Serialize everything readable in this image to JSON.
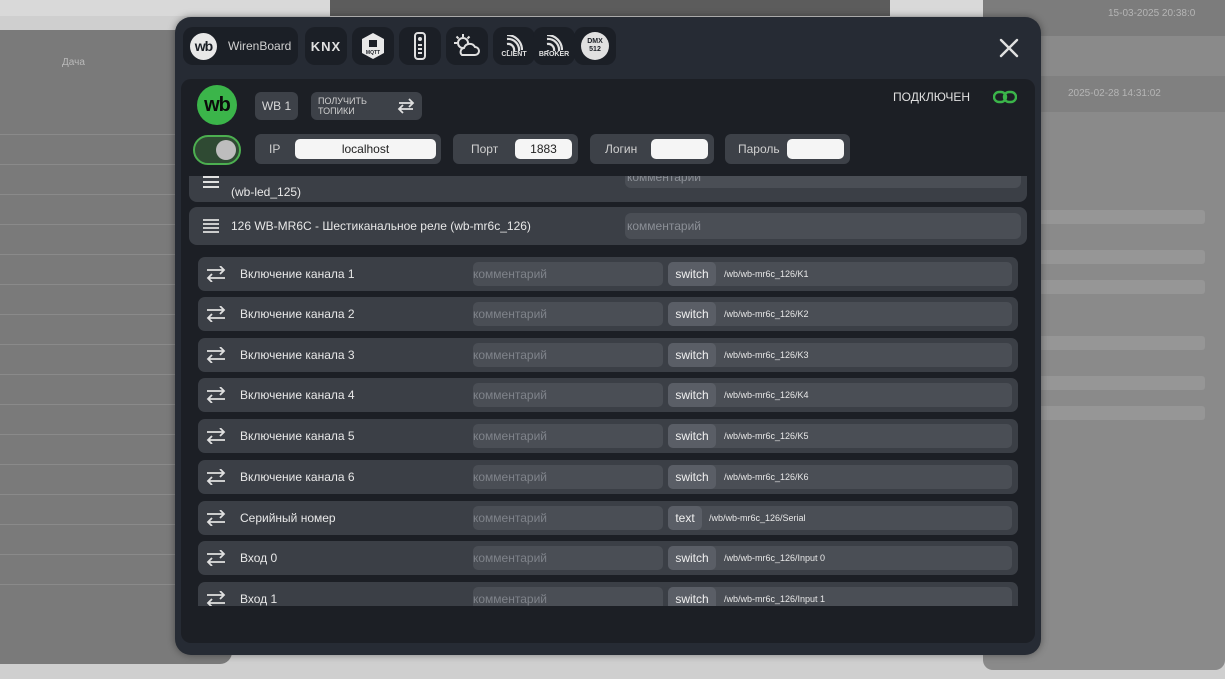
{
  "background": {
    "left_items": [
      "Дача"
    ],
    "right_dates": [
      "15-03-2025 20:38:0",
      "2025-02-28 14:31:02"
    ]
  },
  "tabs": [
    {
      "id": "wirenboard",
      "label": "WirenBoard",
      "logo": "wb",
      "icon": "wb-logo-icon"
    },
    {
      "id": "knx",
      "label": "KNX",
      "icon": "knx-icon"
    },
    {
      "id": "mqtt",
      "label": "MQTT",
      "icon": "mqtt-icon"
    },
    {
      "id": "remote",
      "label": "",
      "icon": "remote-control-icon"
    },
    {
      "id": "weather",
      "label": "",
      "icon": "weather-icon"
    },
    {
      "id": "client",
      "label": "CLIENT",
      "icon": "broadcast-client-icon"
    },
    {
      "id": "broker",
      "label": "BROKER",
      "icon": "broadcast-broker-icon"
    },
    {
      "id": "dmx",
      "label": "DMX 512",
      "icon": "dmx-icon"
    }
  ],
  "panel": {
    "logo": "wb",
    "device_button": "WB 1",
    "topics_button": "ПОЛУЧИТЬ ТОПИКИ",
    "status": "ПОДКЛЮЧЕН",
    "toggle_on": true,
    "fields": {
      "ip": {
        "label": "IP",
        "value": "localhost"
      },
      "port": {
        "label": "Порт",
        "value": "1883"
      },
      "login": {
        "label": "Логин",
        "value": ""
      },
      "password": {
        "label": "Пароль",
        "value": ""
      }
    }
  },
  "comment_placeholder": "комментарий",
  "devices": [
    {
      "title": "(wb-led_125)",
      "comment": "комментарий"
    },
    {
      "title": "126 WB-MR6C - Шестиканальное реле (wb-mr6c_126)",
      "comment": "комментарий"
    }
  ],
  "channels": [
    {
      "name": "Включение канала 1",
      "type": "switch",
      "topic": "/wb/wb-mr6c_126/K1"
    },
    {
      "name": "Включение канала 2",
      "type": "switch",
      "topic": "/wb/wb-mr6c_126/K2"
    },
    {
      "name": "Включение канала 3",
      "type": "switch",
      "topic": "/wb/wb-mr6c_126/K3"
    },
    {
      "name": "Включение канала 4",
      "type": "switch",
      "topic": "/wb/wb-mr6c_126/K4"
    },
    {
      "name": "Включение канала 5",
      "type": "switch",
      "topic": "/wb/wb-mr6c_126/K5"
    },
    {
      "name": "Включение канала 6",
      "type": "switch",
      "topic": "/wb/wb-mr6c_126/K6"
    },
    {
      "name": "Серийный номер",
      "type": "text",
      "topic": "/wb/wb-mr6c_126/Serial"
    },
    {
      "name": "Вход 0",
      "type": "switch",
      "topic": "/wb/wb-mr6c_126/Input 0"
    },
    {
      "name": "Вход 1",
      "type": "switch",
      "topic": "/wb/wb-mr6c_126/Input 1"
    }
  ],
  "colors": {
    "accent": "#3bb54a",
    "modal_bg": "#262b34",
    "row_bg": "#3b3f46"
  }
}
